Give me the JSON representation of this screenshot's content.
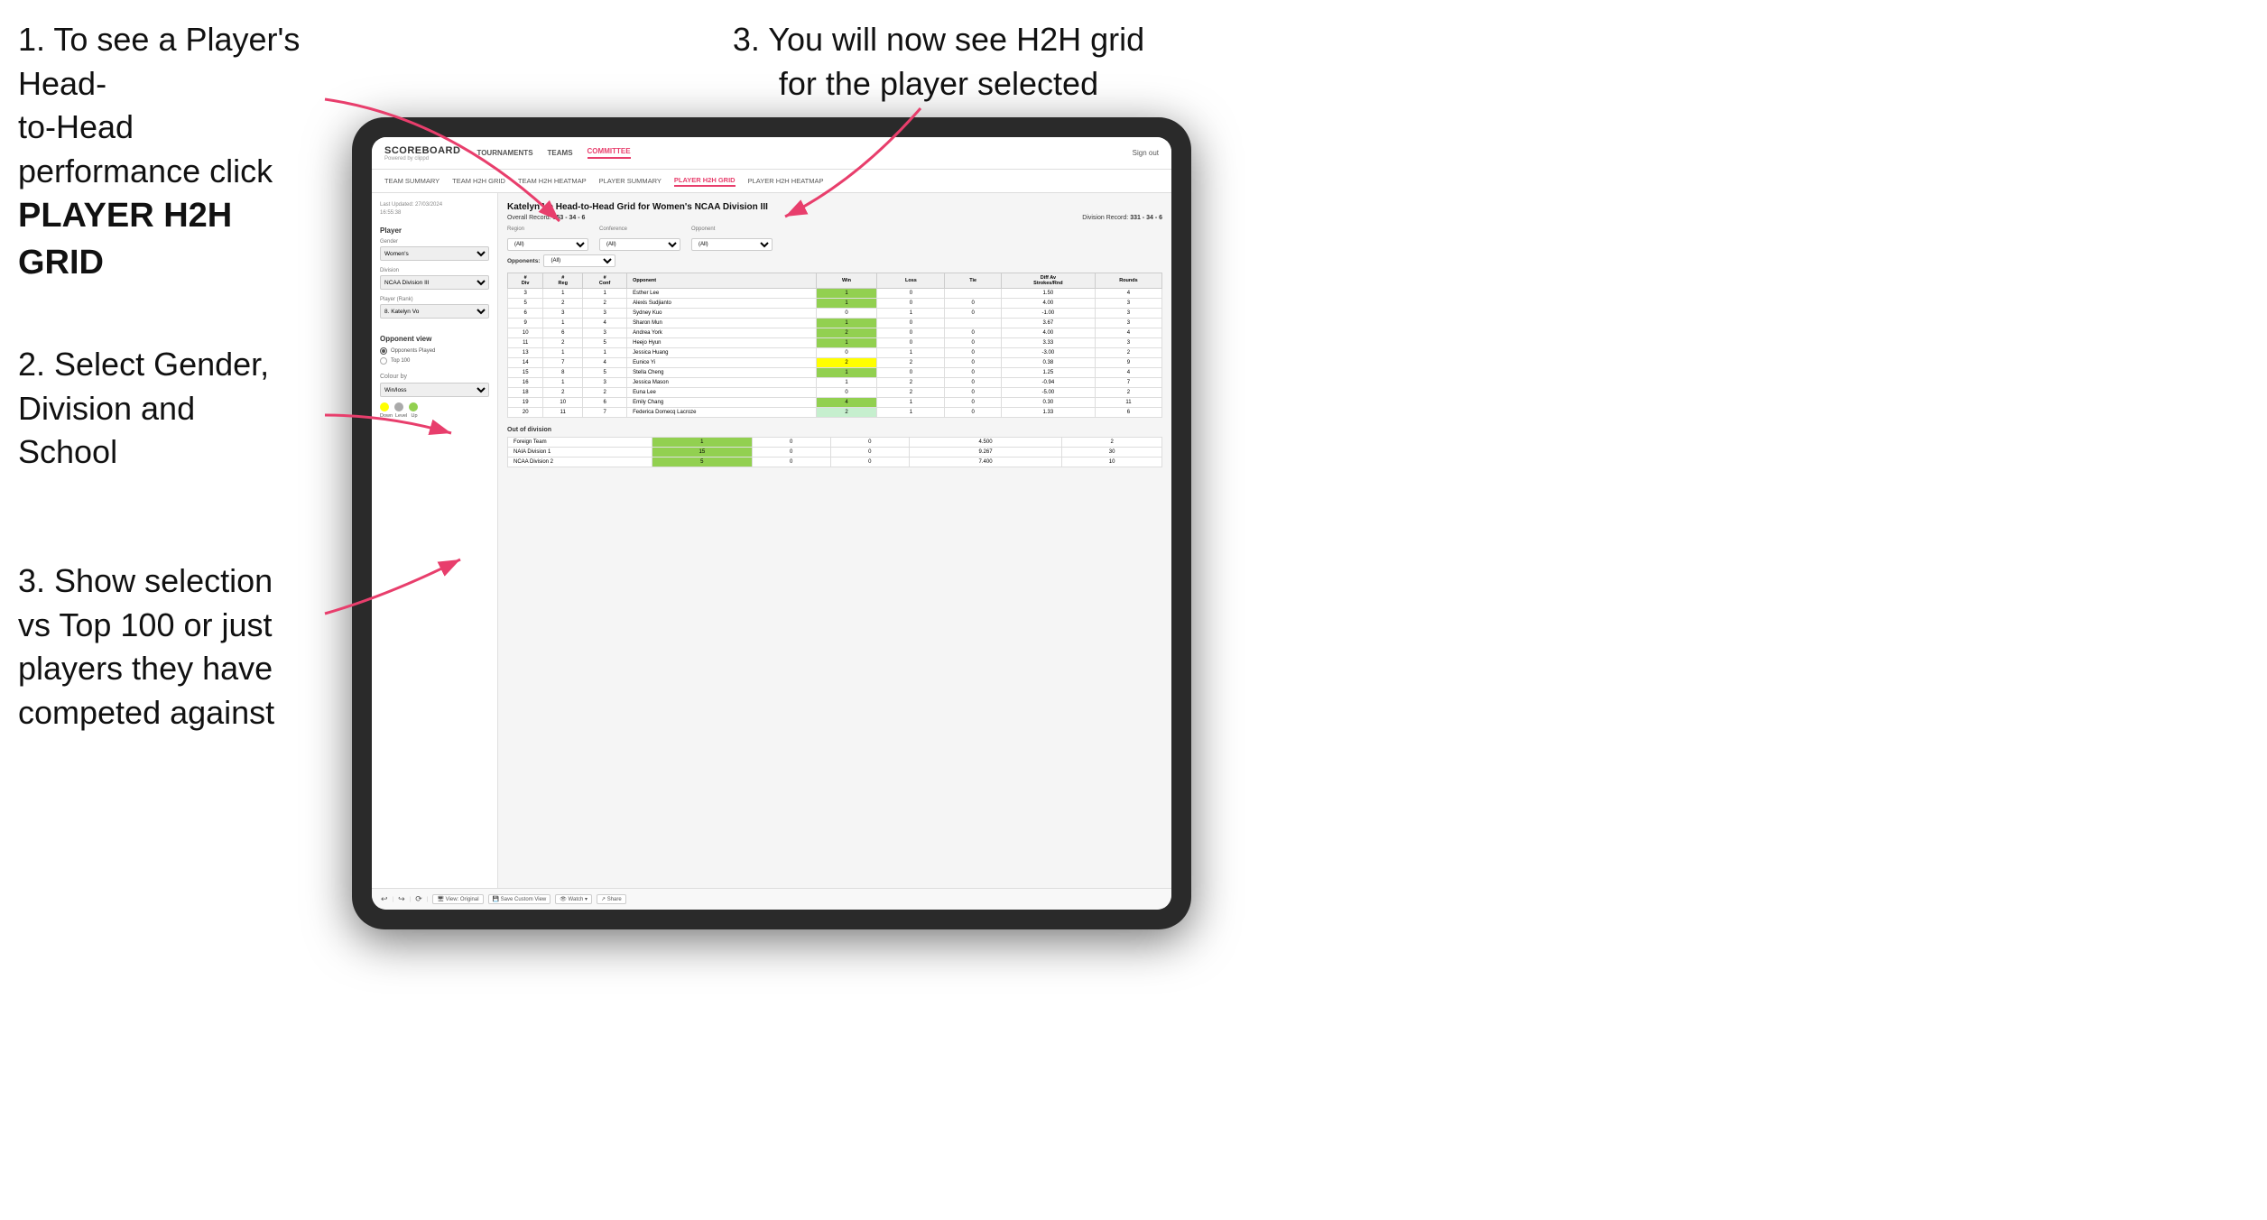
{
  "instructions": {
    "step1_line1": "1. To see a Player's Head-",
    "step1_line2": "to-Head performance click",
    "step1_bold": "PLAYER H2H GRID",
    "step2_line1": "2. Select Gender,",
    "step2_line2": "Division and",
    "step2_line3": "School",
    "step3a_line1": "3. You will now see H2H grid",
    "step3a_line2": "for the player selected",
    "step3b_line1": "3. Show selection",
    "step3b_line2": "vs Top 100 or just",
    "step3b_line3": "players they have",
    "step3b_line4": "competed against"
  },
  "app": {
    "logo": "SCOREBOARD",
    "logo_sub": "Powered by clippd",
    "sign_out": "Sign out",
    "nav_items": [
      "TOURNAMENTS",
      "TEAMS",
      "COMMITTEE"
    ],
    "sub_nav_items": [
      "TEAM SUMMARY",
      "TEAM H2H GRID",
      "TEAM H2H HEATMAP",
      "PLAYER SUMMARY",
      "PLAYER H2H GRID",
      "PLAYER H2H HEATMAP"
    ]
  },
  "left_panel": {
    "timestamp": "Last Updated: 27/03/2024\n16:55:38",
    "player_section": "Player",
    "gender_label": "Gender",
    "gender_value": "Women's",
    "division_label": "Division",
    "division_value": "NCAA Division III",
    "player_rank_label": "Player (Rank)",
    "player_rank_value": "8. Katelyn Vo",
    "opponent_view_label": "Opponent view",
    "radio_played": "Opponents Played",
    "radio_top100": "Top 100",
    "colour_by_label": "Colour by",
    "colour_value": "Win/loss",
    "legend_down": "Down",
    "legend_level": "Level",
    "legend_up": "Up"
  },
  "main": {
    "title": "Katelyn Vo Head-to-Head Grid for Women's NCAA Division III",
    "overall_record_label": "Overall Record:",
    "overall_record_value": "353 - 34 - 6",
    "division_record_label": "Division Record:",
    "division_record_value": "331 - 34 - 6",
    "filter_opponents_label": "Opponents:",
    "filter_region_label": "Region",
    "filter_conference_label": "Conference",
    "filter_opponent_label": "Opponent",
    "filter_all": "(All)",
    "table_headers": [
      "#\nDiv",
      "#\nReg",
      "#\nConf",
      "Opponent",
      "Win",
      "Loss",
      "Tie",
      "Diff Av\nStrokes/Rnd",
      "Rounds"
    ],
    "rows": [
      {
        "div": "3",
        "reg": "1",
        "conf": "1",
        "opponent": "Esther Lee",
        "win": "1",
        "loss": "0",
        "tie": "",
        "diff": "1.50",
        "rounds": "4",
        "win_color": "green",
        "loss_color": "",
        "tie_color": ""
      },
      {
        "div": "5",
        "reg": "2",
        "conf": "2",
        "opponent": "Alexis Sudjianto",
        "win": "1",
        "loss": "0",
        "tie": "0",
        "diff": "4.00",
        "rounds": "3",
        "win_color": "green"
      },
      {
        "div": "6",
        "reg": "3",
        "conf": "3",
        "opponent": "Sydney Kuo",
        "win": "0",
        "loss": "1",
        "tie": "0",
        "diff": "-1.00",
        "rounds": "3"
      },
      {
        "div": "9",
        "reg": "1",
        "conf": "4",
        "opponent": "Sharon Mun",
        "win": "1",
        "loss": "0",
        "tie": "",
        "diff": "3.67",
        "rounds": "3",
        "win_color": "green"
      },
      {
        "div": "10",
        "reg": "6",
        "conf": "3",
        "opponent": "Andrea York",
        "win": "2",
        "loss": "0",
        "tie": "0",
        "diff": "4.00",
        "rounds": "4",
        "win_color": "green"
      },
      {
        "div": "11",
        "reg": "2",
        "conf": "5",
        "opponent": "Heejo Hyun",
        "win": "1",
        "loss": "0",
        "tie": "0",
        "diff": "3.33",
        "rounds": "3",
        "win_color": "green"
      },
      {
        "div": "13",
        "reg": "1",
        "conf": "1",
        "opponent": "Jessica Huang",
        "win": "0",
        "loss": "1",
        "tie": "0",
        "diff": "-3.00",
        "rounds": "2"
      },
      {
        "div": "14",
        "reg": "7",
        "conf": "4",
        "opponent": "Eunice Yi",
        "win": "2",
        "loss": "2",
        "tie": "0",
        "diff": "0.38",
        "rounds": "9",
        "win_color": "yellow"
      },
      {
        "div": "15",
        "reg": "8",
        "conf": "5",
        "opponent": "Stella Cheng",
        "win": "1",
        "loss": "0",
        "tie": "0",
        "diff": "1.25",
        "rounds": "4",
        "win_color": "green"
      },
      {
        "div": "16",
        "reg": "1",
        "conf": "3",
        "opponent": "Jessica Mason",
        "win": "1",
        "loss": "2",
        "tie": "0",
        "diff": "-0.94",
        "rounds": "7"
      },
      {
        "div": "18",
        "reg": "2",
        "conf": "2",
        "opponent": "Euna Lee",
        "win": "0",
        "loss": "2",
        "tie": "0",
        "diff": "-5.00",
        "rounds": "2"
      },
      {
        "div": "19",
        "reg": "10",
        "conf": "6",
        "opponent": "Emily Chang",
        "win": "4",
        "loss": "1",
        "tie": "0",
        "diff": "0.30",
        "rounds": "11",
        "win_color": "green"
      },
      {
        "div": "20",
        "reg": "11",
        "conf": "7",
        "opponent": "Federica Domecq Lacroze",
        "win": "2",
        "loss": "1",
        "tie": "0",
        "diff": "1.33",
        "rounds": "6",
        "win_color": "light-green"
      }
    ],
    "out_of_division_label": "Out of division",
    "ood_rows": [
      {
        "name": "Foreign Team",
        "win": "1",
        "loss": "0",
        "tie": "0",
        "diff": "4.500",
        "rounds": "2",
        "win_color": "green"
      },
      {
        "name": "NAIA Division 1",
        "win": "15",
        "loss": "0",
        "tie": "0",
        "diff": "9.267",
        "rounds": "30",
        "win_color": "green"
      },
      {
        "name": "NCAA Division 2",
        "win": "5",
        "loss": "0",
        "tie": "0",
        "diff": "7.400",
        "rounds": "10",
        "win_color": "green"
      }
    ]
  },
  "toolbar": {
    "view_original": "View: Original",
    "save_custom": "Save Custom View",
    "watch": "Watch",
    "share": "Share"
  }
}
